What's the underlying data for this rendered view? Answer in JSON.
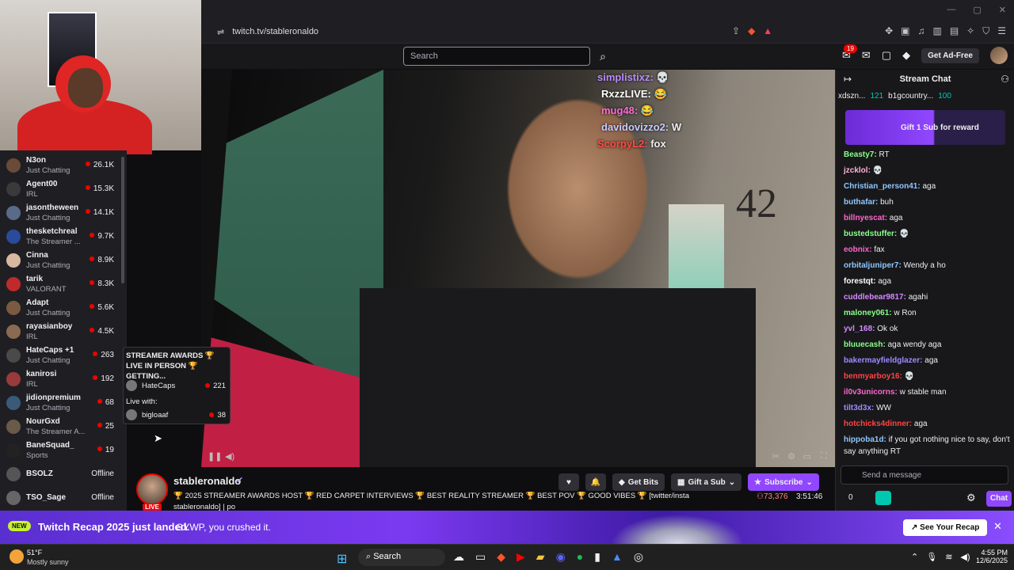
{
  "browser": {
    "url": "twitch.tv/stableronaldo",
    "window_controls": [
      "—",
      "▢",
      "✕"
    ]
  },
  "topnav": {
    "search_placeholder": "Search",
    "notif_count": "19",
    "ad_free_label": "Get Ad-Free"
  },
  "sidebar": {
    "channels": [
      {
        "name": "N3on",
        "game": "Just Chatting",
        "viewers": "26.1K",
        "color": "#6a4a38"
      },
      {
        "name": "Agent00",
        "game": "IRL",
        "viewers": "15.3K",
        "color": "#3a3a3a"
      },
      {
        "name": "jasontheween",
        "game": "Just Chatting",
        "viewers": "14.1K",
        "color": "#5a6a8a"
      },
      {
        "name": "thesketchreal",
        "game": "The Streamer ...",
        "viewers": "9.7K",
        "color": "#2a4a9a"
      },
      {
        "name": "Cinna",
        "game": "Just Chatting",
        "viewers": "8.9K",
        "color": "#d9b8a0"
      },
      {
        "name": "tarik",
        "game": "VALORANT",
        "viewers": "8.3K",
        "color": "#c02a2a"
      },
      {
        "name": "Adapt",
        "game": "Just Chatting",
        "viewers": "5.6K",
        "color": "#7a5a40"
      },
      {
        "name": "rayasianboy",
        "game": "IRL",
        "viewers": "4.5K",
        "color": "#8a6a50"
      },
      {
        "name": "HateCaps +1",
        "game": "Just Chatting",
        "viewers": "263",
        "color": "#4a4a4a"
      },
      {
        "name": "kanirosi",
        "game": "IRL",
        "viewers": "192",
        "color": "#9a3a3a"
      },
      {
        "name": "jidionpremium",
        "game": "Just Chatting",
        "viewers": "68",
        "color": "#3a5a7a"
      },
      {
        "name": "NourGxd",
        "game": "The Streamer A...",
        "viewers": "25",
        "color": "#6a5a4a"
      },
      {
        "name": "BaneSquad_",
        "game": "Sports",
        "viewers": "19",
        "color": "#222"
      },
      {
        "name": "BSOLZ",
        "game": "",
        "viewers": "Offline",
        "color": "#555"
      },
      {
        "name": "TSO_Sage",
        "game": "",
        "viewers": "Offline",
        "color": "#666"
      }
    ]
  },
  "tooltip": {
    "title": "STREAMER AWARDS 🏆 LIVE IN PERSON 🏆 GETTING...",
    "host": "HateCaps",
    "host_viewers": "221",
    "live_with_label": "Live with:",
    "guest": "bigloaaf",
    "guest_viewers": "38"
  },
  "video": {
    "overlay_chat": [
      {
        "user": "simplistixz:",
        "text": "💀",
        "color": "#b98cff"
      },
      {
        "user": "RxzzLIVE:",
        "text": "😂",
        "color": "#ffffff"
      },
      {
        "user": "mug48:",
        "text": "😂",
        "color": "#ff6ad5"
      },
      {
        "user": "davidovizzo2:",
        "text": "W",
        "color": "#c9c9ff"
      },
      {
        "user": "ScorpyL2:",
        "text": "fox",
        "color": "#ff4a4a"
      }
    ]
  },
  "stream": {
    "name": "stableronaldo",
    "live": "LIVE",
    "title": "🏆 2025 STREAMER AWARDS HOST 🏆 RED CARPET INTERVIEWS 🏆 BEST REALITY STREAMER 🏆 BEST POV 🏆 GOOD VIBES 🏆 [twitter/insta",
    "title2": "stableronaldo] | po",
    "viewers": "73,376",
    "uptime": "3:51:46",
    "get_bits": "Get Bits",
    "gift_sub": "Gift a Sub",
    "subscribe": "Subscribe"
  },
  "chat": {
    "title": "Stream Chat",
    "gifters": [
      "xdszn...",
      "121",
      "b1gcountry...",
      "100"
    ],
    "gift_banner": "Gift 1 Sub for reward",
    "messages": [
      {
        "user": "Beasty7:",
        "text": " RT",
        "color": "#8aff8a"
      },
      {
        "user": "jzcklol:",
        "text": " 💀",
        "color": "#ffb3d9"
      },
      {
        "user": "Christian_person41:",
        "text": " aga",
        "color": "#8fc7ff"
      },
      {
        "user": "buthafar:",
        "text": " buh",
        "color": "#8fc7ff"
      },
      {
        "user": "billnyescat:",
        "text": " aga",
        "color": "#ff66cc"
      },
      {
        "user": "bustedstuffer:",
        "text": " 💀",
        "color": "#8aff8a"
      },
      {
        "user": "eobnix:",
        "text": " fax",
        "color": "#ff66cc"
      },
      {
        "user": "orbitaljuniper7:",
        "text": " Wendy a ho",
        "color": "#8fc7ff"
      },
      {
        "user": "forestqt:",
        "text": " aga",
        "color": "#ffffff"
      },
      {
        "user": "cuddlebear9817:",
        "text": " agahi",
        "color": "#d68aff"
      },
      {
        "user": "maloney061:",
        "text": " w Ron",
        "color": "#8aff8a"
      },
      {
        "user": "yvl_168:",
        "text": " Ok ok",
        "color": "#d68aff"
      },
      {
        "user": "bluuecash:",
        "text": " aga wendy aga",
        "color": "#8aff8a"
      },
      {
        "user": "bakermayfieldglazer:",
        "text": " aga",
        "color": "#9f8aff"
      },
      {
        "user": "benmyarboy16:",
        "text": " 💀",
        "color": "#ff4444"
      },
      {
        "user": "il0v3unicorns:",
        "text": " w stable man",
        "color": "#ff66cc"
      },
      {
        "user": "tilt3d3x:",
        "text": " WW",
        "color": "#9f8aff"
      },
      {
        "user": "hotchicks4dinner:",
        "text": " aga",
        "color": "#ff4444"
      },
      {
        "user": "hippoba1d:",
        "text": " if you got nothing nice to say, don't say anything RT",
        "color": "#8fc7ff"
      }
    ],
    "input_placeholder": "Send a message",
    "points": "0",
    "chat_button": "Chat"
  },
  "recap": {
    "new": "NEW",
    "title": "Twitch Recap 2025 just landed.",
    "subtitle": "GYWP, you crushed it.",
    "button": "See Your Recap"
  },
  "taskbar": {
    "temp": "51°F",
    "condition": "Mostly sunny",
    "search": "Search",
    "time": "4:55 PM",
    "date": "12/6/2025"
  },
  "webcam": {
    "poster_text": ""
  }
}
